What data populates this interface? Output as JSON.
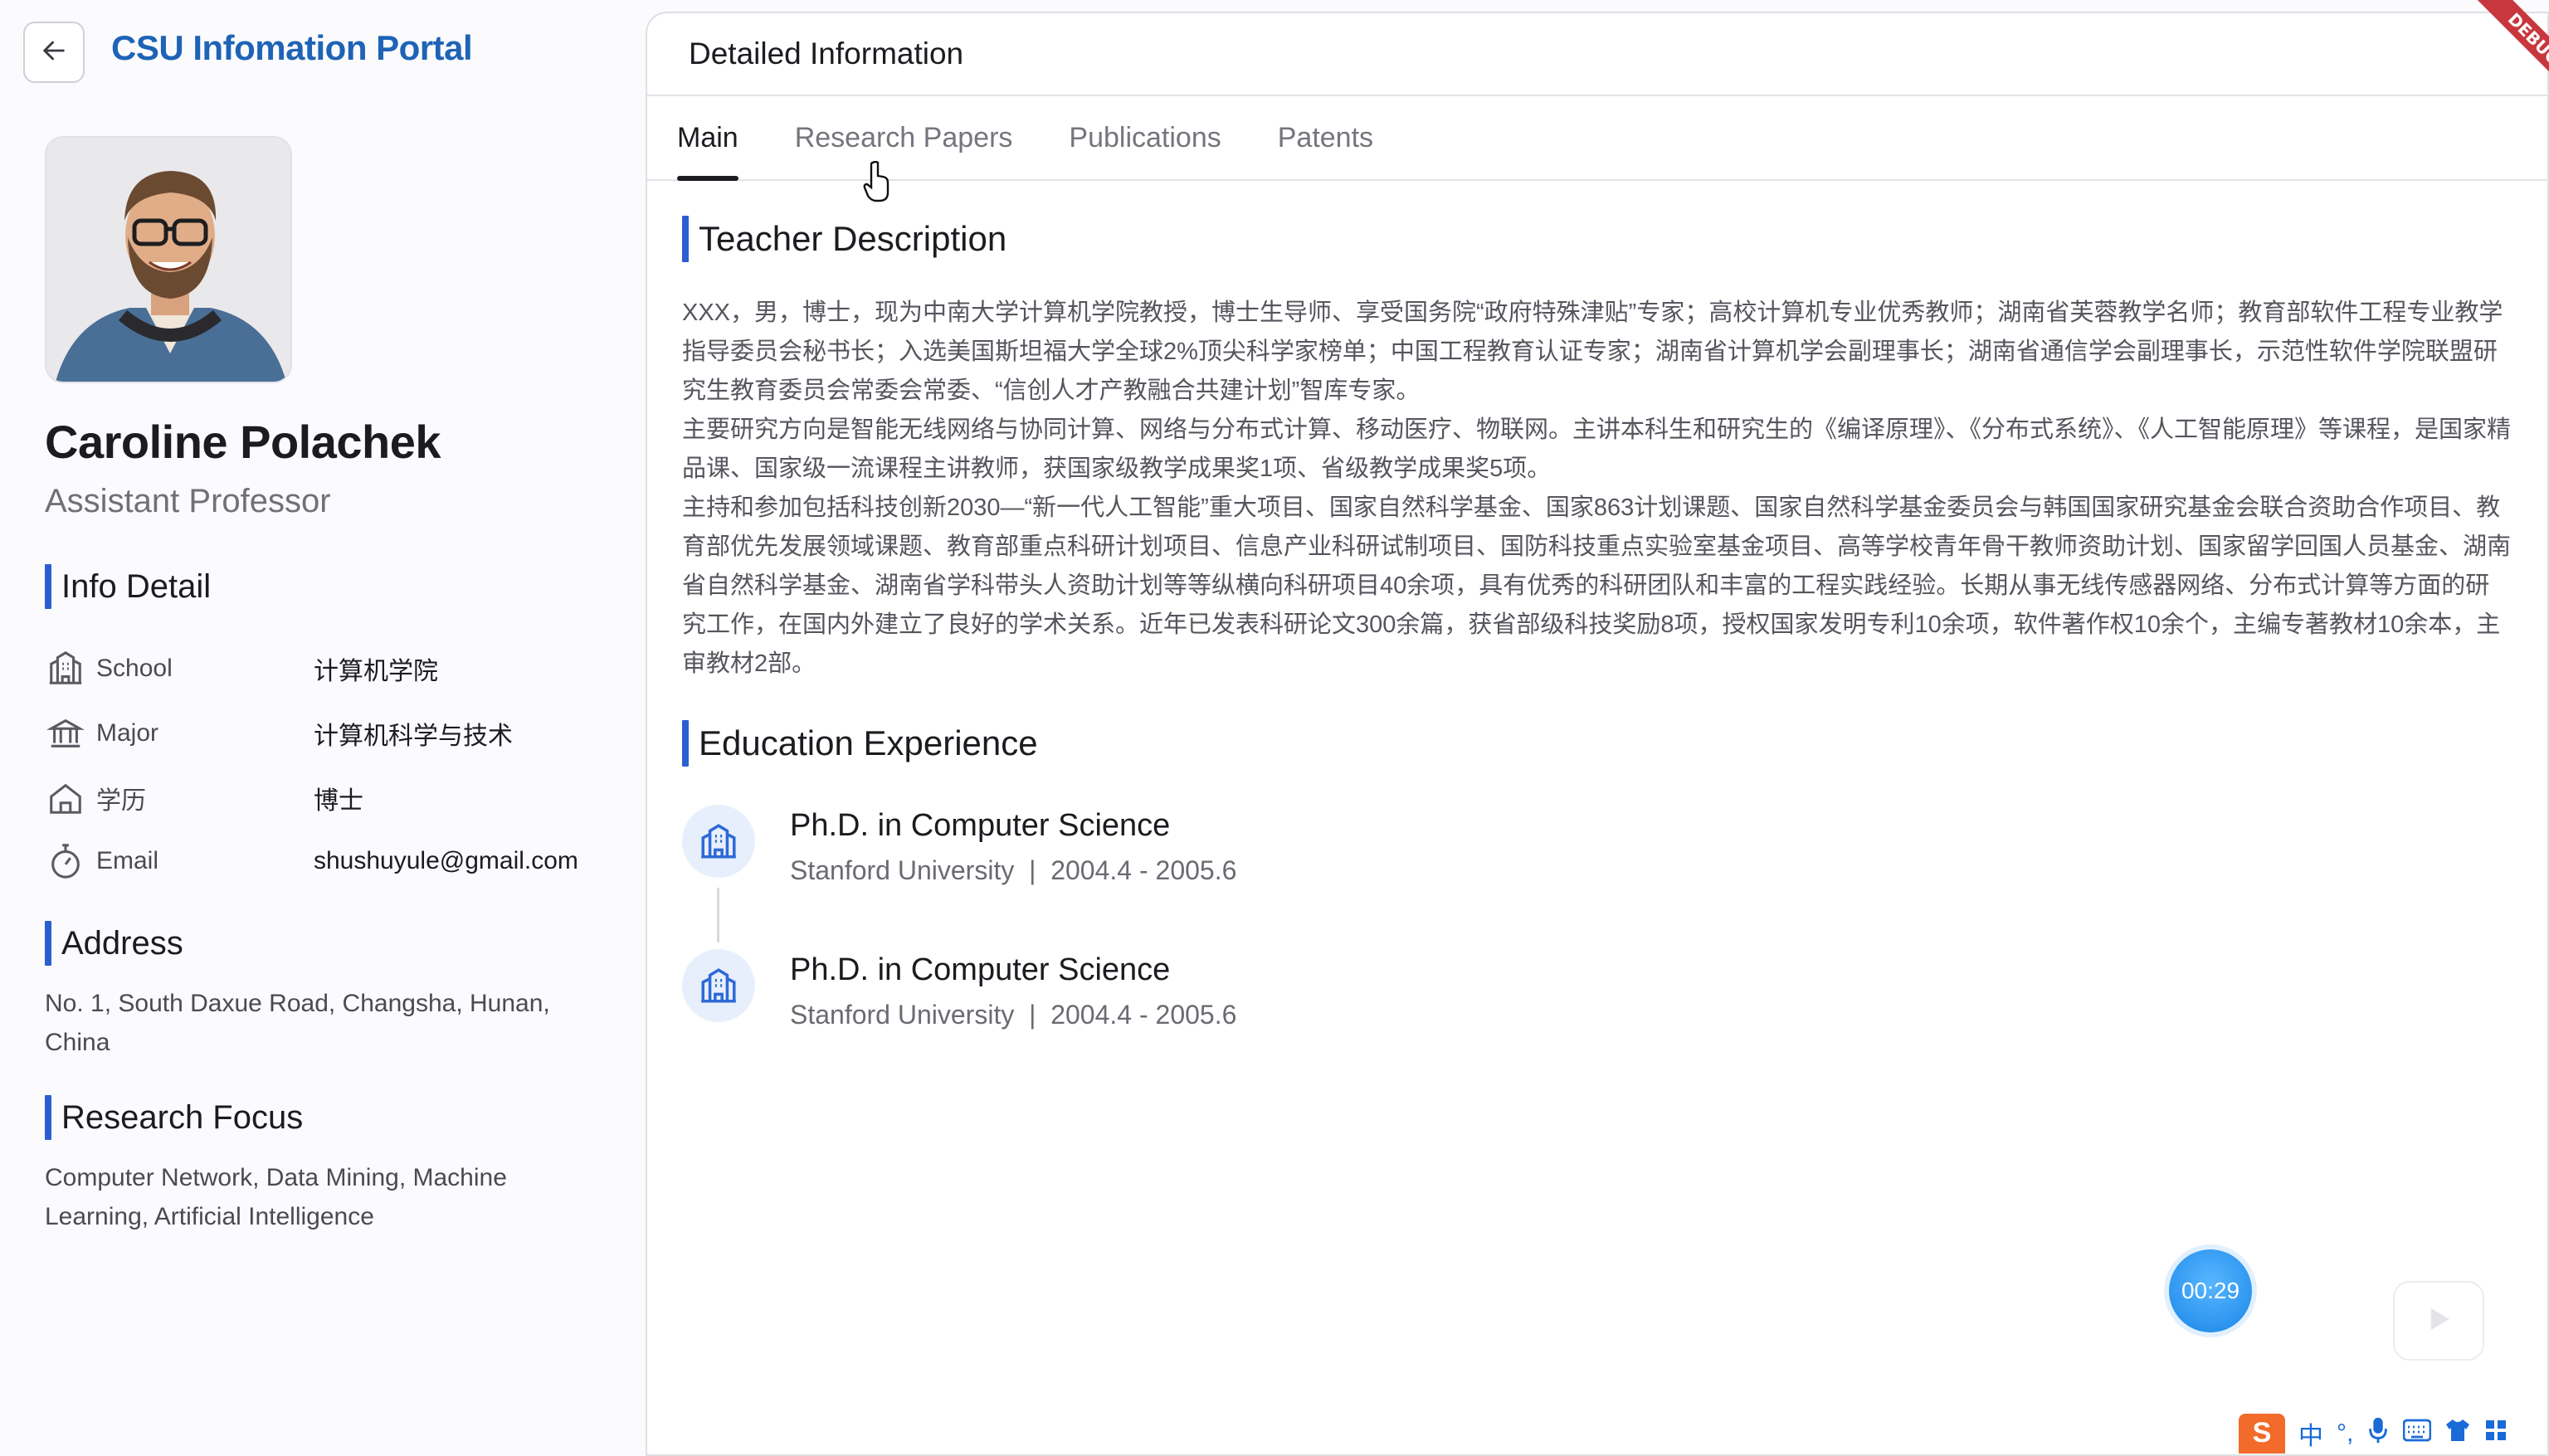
{
  "header": {
    "portal_title": "CSU Infomation Portal"
  },
  "profile": {
    "name": "Caroline Polachek",
    "role": "Assistant Professor"
  },
  "info_detail": {
    "title": "Info Detail",
    "rows": [
      {
        "label": "School",
        "value": "计算机学院",
        "icon": "school-icon"
      },
      {
        "label": "Major",
        "value": "计算机科学与技术",
        "icon": "institution-icon"
      },
      {
        "label": "学历",
        "value": "博士",
        "icon": "home-icon"
      },
      {
        "label": "Email",
        "value": "shushuyule@gmail.com",
        "icon": "stopwatch-icon"
      }
    ]
  },
  "address": {
    "title": "Address",
    "text": "No. 1, South Daxue Road, Changsha, Hunan, China"
  },
  "research_focus": {
    "title": "Research Focus",
    "text": "Computer Network, Data Mining, Machine Learning, Artificial Intelligence"
  },
  "detail_panel": {
    "title": "Detailed Information",
    "tabs": [
      {
        "label": "Main",
        "active": true
      },
      {
        "label": "Research Papers",
        "active": false
      },
      {
        "label": "Publications",
        "active": false
      },
      {
        "label": "Patents",
        "active": false
      }
    ],
    "teacher_description": {
      "title": "Teacher Description",
      "paragraphs": [
        "XXX，男，博士，现为中南大学计算机学院教授，博士生导师、享受国务院“政府特殊津贴”专家；高校计算机专业优秀教师；湖南省芙蓉教学名师；教育部软件工程专业教学指导委员会秘书长；入选美国斯坦福大学全球2%顶尖科学家榜单；中国工程教育认证专家；湖南省计算机学会副理事长；湖南省通信学会副理事长，示范性软件学院联盟研究生教育委员会常委会常委、“信创人才产教融合共建计划”智库专家。",
        "主要研究方向是智能无线网络与协同计算、网络与分布式计算、移动医疗、物联网。主讲本科生和研究生的《编译原理》、《分布式系统》、《人工智能原理》等课程，是国家精品课、国家级一流课程主讲教师，获国家级教学成果奖1项、省级教学成果奖5项。",
        "主持和参加包括科技创新2030—“新一代人工智能”重大项目、国家自然科学基金、国家863计划课题、国家自然科学基金委员会与韩国国家研究基金会联合资助合作项目、教育部优先发展领域课题、教育部重点科研计划项目、信息产业科研试制项目、国防科技重点实验室基金项目、高等学校青年骨干教师资助计划、国家留学回国人员基金、湖南省自然科学基金、湖南省学科带头人资助计划等等纵横向科研项目40余项，具有优秀的科研团队和丰富的工程实践经验。长期从事无线传感器网络、分布式计算等方面的研究工作，在国内外建立了良好的学术关系。近年已发表科研论文300余篇，获省部级科技奖励8项，授权国家发明专利10余项，软件著作权10余个，主编专著教材10余本，主审教材2部。"
      ]
    },
    "education": {
      "title": "Education Experience",
      "items": [
        {
          "degree": "Ph.D. in Computer Science",
          "school": "Stanford University",
          "period": "2004.4 - 2005.6"
        },
        {
          "degree": "Ph.D. in Computer Science",
          "school": "Stanford University",
          "period": "2004.4 - 2005.6"
        }
      ]
    }
  },
  "overlay": {
    "timer": "00:29",
    "debug_ribbon": "DEBUG",
    "ime": {
      "lang": "中",
      "punct": "°,"
    }
  },
  "colors": {
    "accent": "#2b5fd0",
    "portal_title": "#1e63b6",
    "debug": "#c8373d"
  }
}
